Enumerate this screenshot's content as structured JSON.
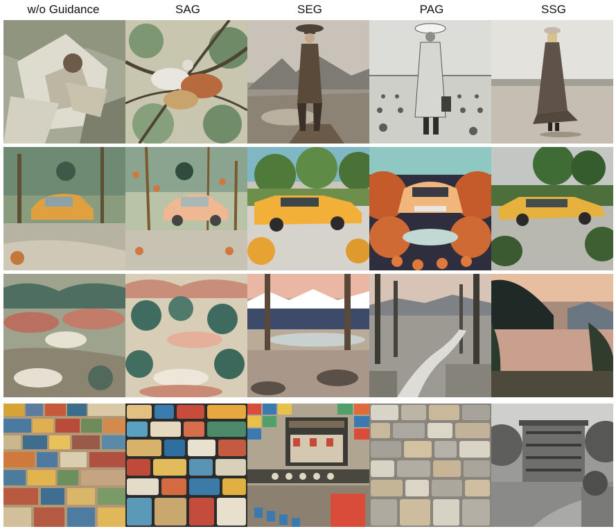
{
  "columns": [
    "w/o Guidance",
    "SAG",
    "SEG",
    "PAG",
    "SSG"
  ],
  "rows": [
    {
      "subject": "woman-in-hat"
    },
    {
      "subject": "yellow-car"
    },
    {
      "subject": "landscape-river"
    },
    {
      "subject": "mosaic-wall"
    }
  ]
}
